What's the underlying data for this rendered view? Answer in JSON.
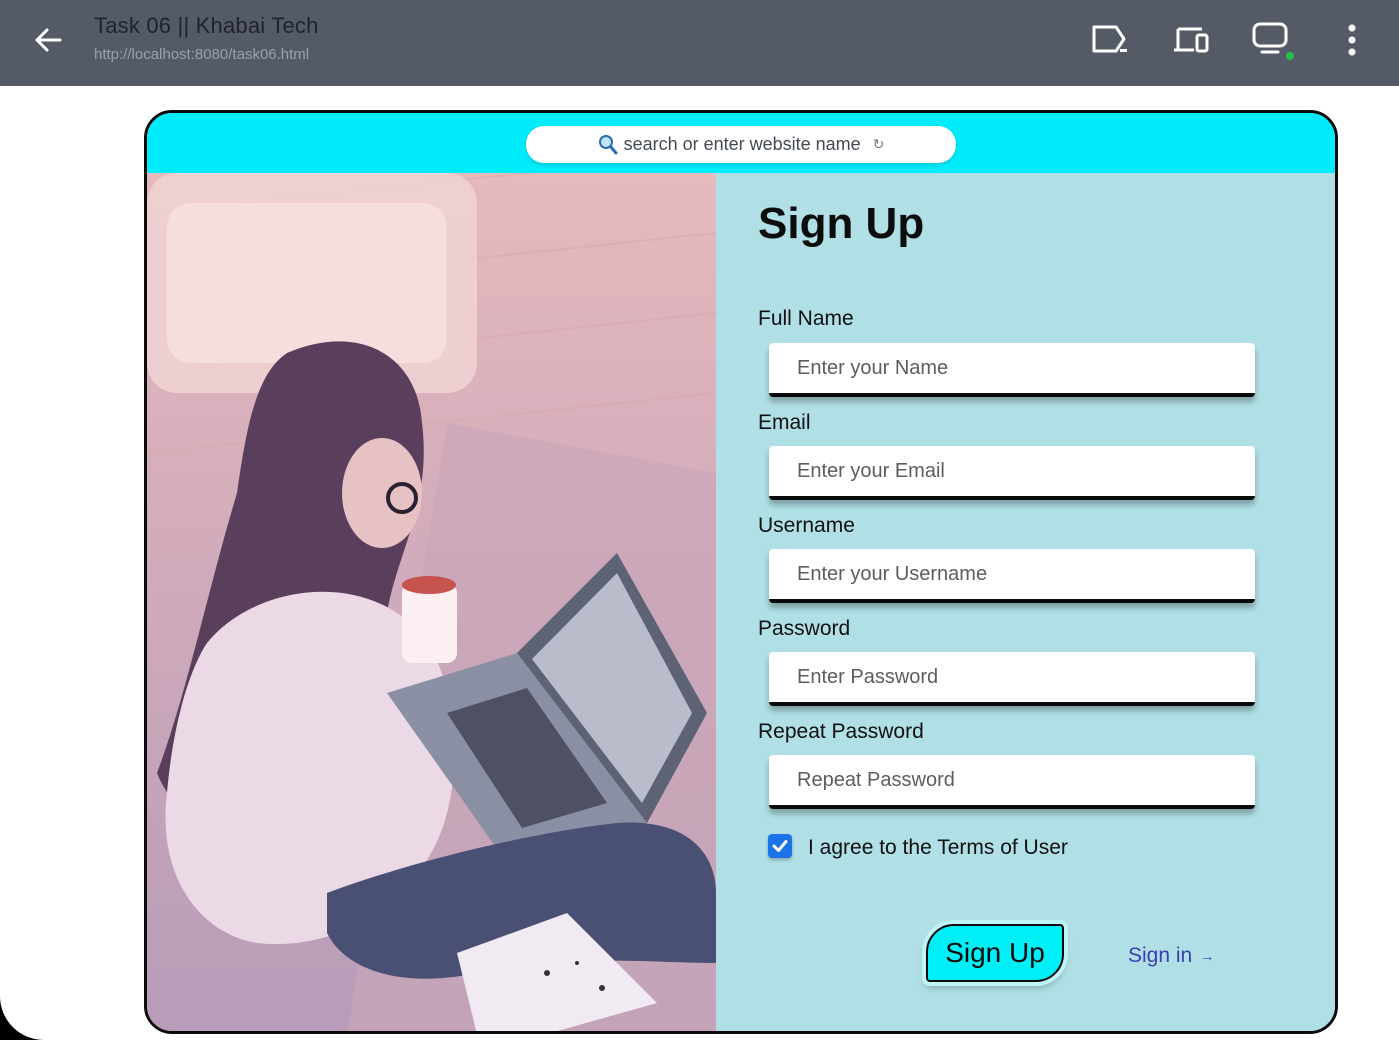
{
  "topbar": {
    "title": "Task 06 || Khabai Tech",
    "url": "http://localhost:8080/task06.html",
    "icons": [
      "back-arrow-icon",
      "cast-icon",
      "devices-icon",
      "monitor-icon",
      "more-vertical-icon"
    ],
    "status_dot_color": "#27c24c"
  },
  "browser": {
    "address_placeholder": "search or enter website name",
    "strip_color": "#00ecfb"
  },
  "form": {
    "heading": "Sign Up",
    "fields": [
      {
        "label": "Full Name",
        "placeholder": "Enter your Name",
        "value": ""
      },
      {
        "label": "Email",
        "placeholder": "Enter your Email",
        "value": ""
      },
      {
        "label": "Username",
        "placeholder": "Enter your Username",
        "value": ""
      },
      {
        "label": "Password",
        "placeholder": "Enter Password",
        "value": ""
      },
      {
        "label": "Repeat Password",
        "placeholder": "Repeat Password",
        "value": ""
      }
    ],
    "terms_label": "I agree to the Terms of User",
    "terms_checked": true,
    "submit_label": "Sign Up",
    "signin_label": "Sign in",
    "panel_color": "#b0dfe5",
    "button_color": "#00eef5"
  }
}
